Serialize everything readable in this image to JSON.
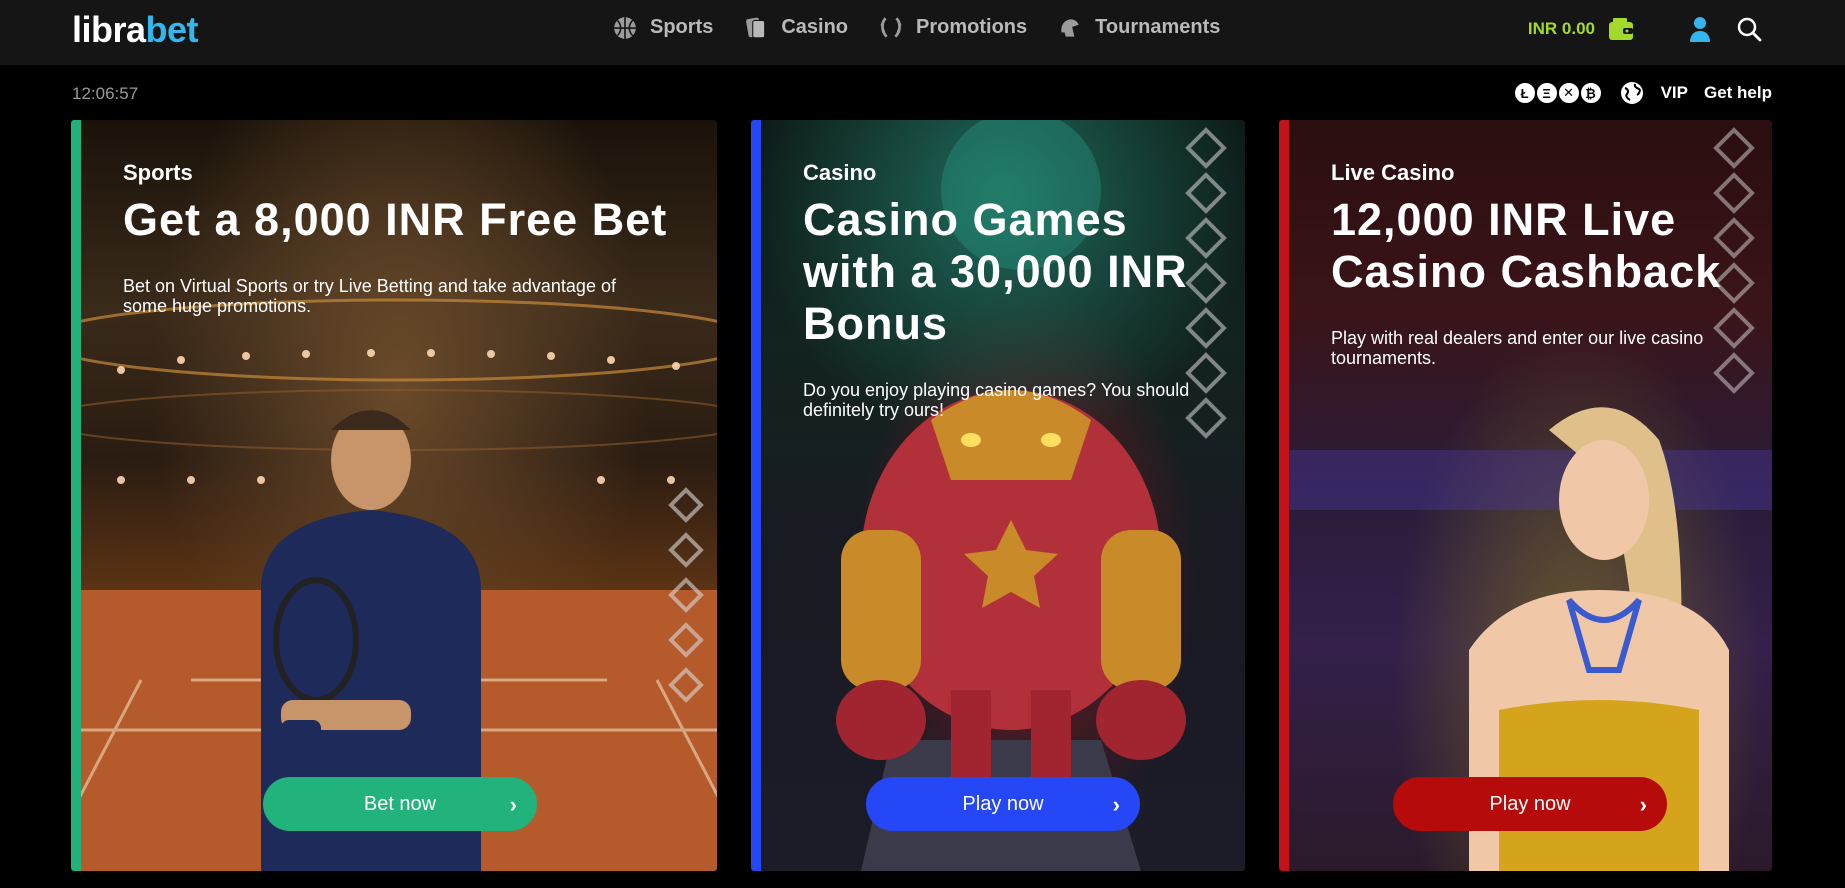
{
  "header": {
    "logo_part1": "libra",
    "logo_part2": "bet",
    "nav": [
      {
        "label": "Sports",
        "icon": "basketball-icon"
      },
      {
        "label": "Casino",
        "icon": "cards-icon"
      },
      {
        "label": "Promotions",
        "icon": "laurel-icon"
      },
      {
        "label": "Tournaments",
        "icon": "helmet-icon"
      }
    ],
    "wallet_balance": "INR 0.00"
  },
  "subbar": {
    "clock": "12:06:57",
    "crypto": [
      "Ł",
      "Ξ",
      "✕",
      "₿"
    ],
    "vip": "VIP",
    "help": "Get help"
  },
  "cards": [
    {
      "category": "Sports",
      "headline": "Get a 8,000 INR Free Bet",
      "description": "Bet on Virtual Sports or try Live Betting and take advantage of some huge promotions.",
      "cta": "Bet now",
      "accent": "#20b27a"
    },
    {
      "category": "Casino",
      "headline": "Casino Games with a 30,000 INR Bonus",
      "description": "Do you enjoy playing casino games? You should definitely try ours!",
      "cta": "Play now",
      "accent": "#2547f6"
    },
    {
      "category": "Live Casino",
      "headline": "12,000 INR Live Casino Cashback",
      "description": "Play with real dealers and enter our live casino tournaments.",
      "cta": "Play now",
      "accent": "#c4121b"
    }
  ],
  "colors": {
    "header_bg": "#151515",
    "logo_accent": "#33b5ee",
    "wallet": "#a3d92a",
    "nav_text": "#b9b9b9"
  }
}
